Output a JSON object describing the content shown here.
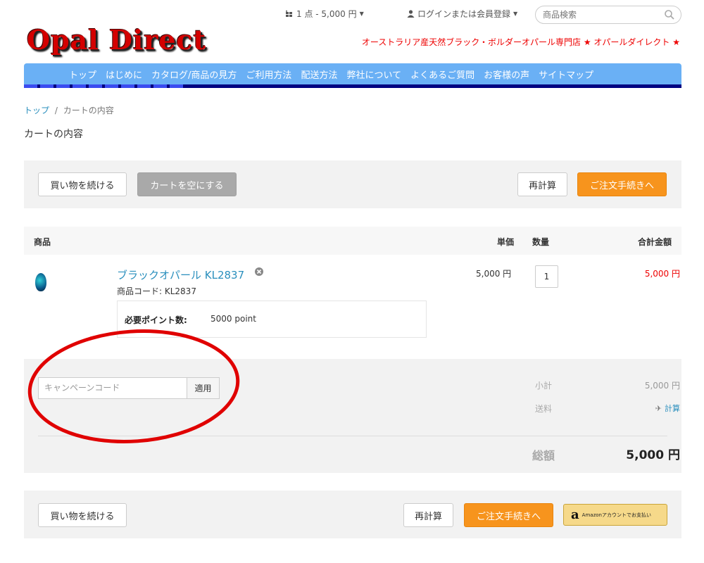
{
  "header": {
    "cart_summary": "1 点 - 5,000 円",
    "login_link": "ログインまたは会員登録",
    "search_placeholder": "商品検索",
    "logo_text": "Opal Direct",
    "tagline": "オーストラリア産天然ブラック・ボルダーオパール専門店 ★ オパールダイレクト ★"
  },
  "nav": {
    "items": [
      "トップ",
      "はじめに",
      "カタログ/商品の見方",
      "ご利用方法",
      "配送方法",
      "弊社について",
      "よくあるご質問",
      "お客様の声",
      "サイトマップ"
    ]
  },
  "breadcrumb": {
    "home": "トップ",
    "sep": "/",
    "current": "カートの内容"
  },
  "page_title": "カートの内容",
  "actions_top": {
    "continue": "買い物を続ける",
    "empty": "カートを空にする",
    "recalc": "再計算",
    "checkout": "ご注文手続きへ"
  },
  "table": {
    "headers": {
      "product": "商品",
      "unit_price": "単価",
      "qty": "数量",
      "total": "合計金額"
    },
    "row": {
      "name": "ブラックオパール KL2837",
      "code": "商品コード: KL2837",
      "points_label": "必要ポイント数:",
      "points_value": "5000 point",
      "unit_price": "5,000 円",
      "qty": "1",
      "total": "5,000 円"
    }
  },
  "totals": {
    "coupon_placeholder": "キャンペーンコード",
    "coupon_apply": "適用",
    "subtotal_label": "小計",
    "subtotal_value": "5,000 円",
    "shipping_label": "送料",
    "shipping_calc": "計算",
    "grand_label": "総額",
    "grand_value": "5,000 円"
  },
  "actions_bottom": {
    "continue": "買い物を続ける",
    "recalc": "再計算",
    "checkout": "ご注文手続きへ",
    "amazon": "Amazonアカウントでお支払い"
  },
  "colors": {
    "accent": "#f7941d",
    "link": "#2a8fbd",
    "nav": "#6ab0f5",
    "price_red": "#ee0000",
    "annotation": "#e00000"
  }
}
